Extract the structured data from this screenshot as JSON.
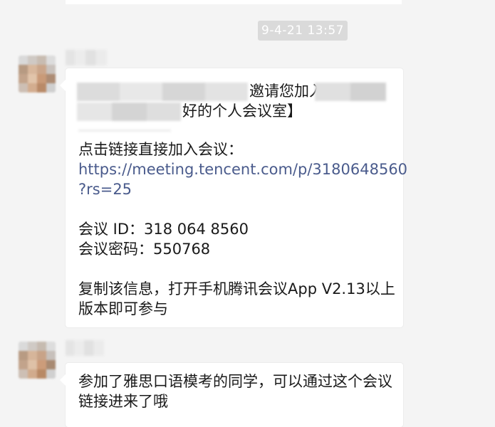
{
  "timestamp": "9-4-21 13:57",
  "message1": {
    "invite_fragment": "邀请您加入",
    "room_fragment": "好的个人会议室】",
    "link_intro": "点击链接直接加入会议：",
    "link_line1": "https://meeting.tencent.com/p/3180648560",
    "link_line2": "?rs=25",
    "meeting_id": "会议 ID：318 064 8560",
    "meeting_password": "会议密码：550768",
    "instructions_line1": "复制该信息，打开手机腾讯会议App V2.13以上",
    "instructions_line2": "版本即可参与"
  },
  "message2": {
    "text_line1": "参加了雅思口语模考的同学，可以通过这个会议",
    "text_line2": "链接进来了哦"
  },
  "colors": {
    "background": "#f4f4f4",
    "bubble": "#ffffff",
    "link": "#4a5b8c",
    "timestamp_bg": "#dadada"
  }
}
